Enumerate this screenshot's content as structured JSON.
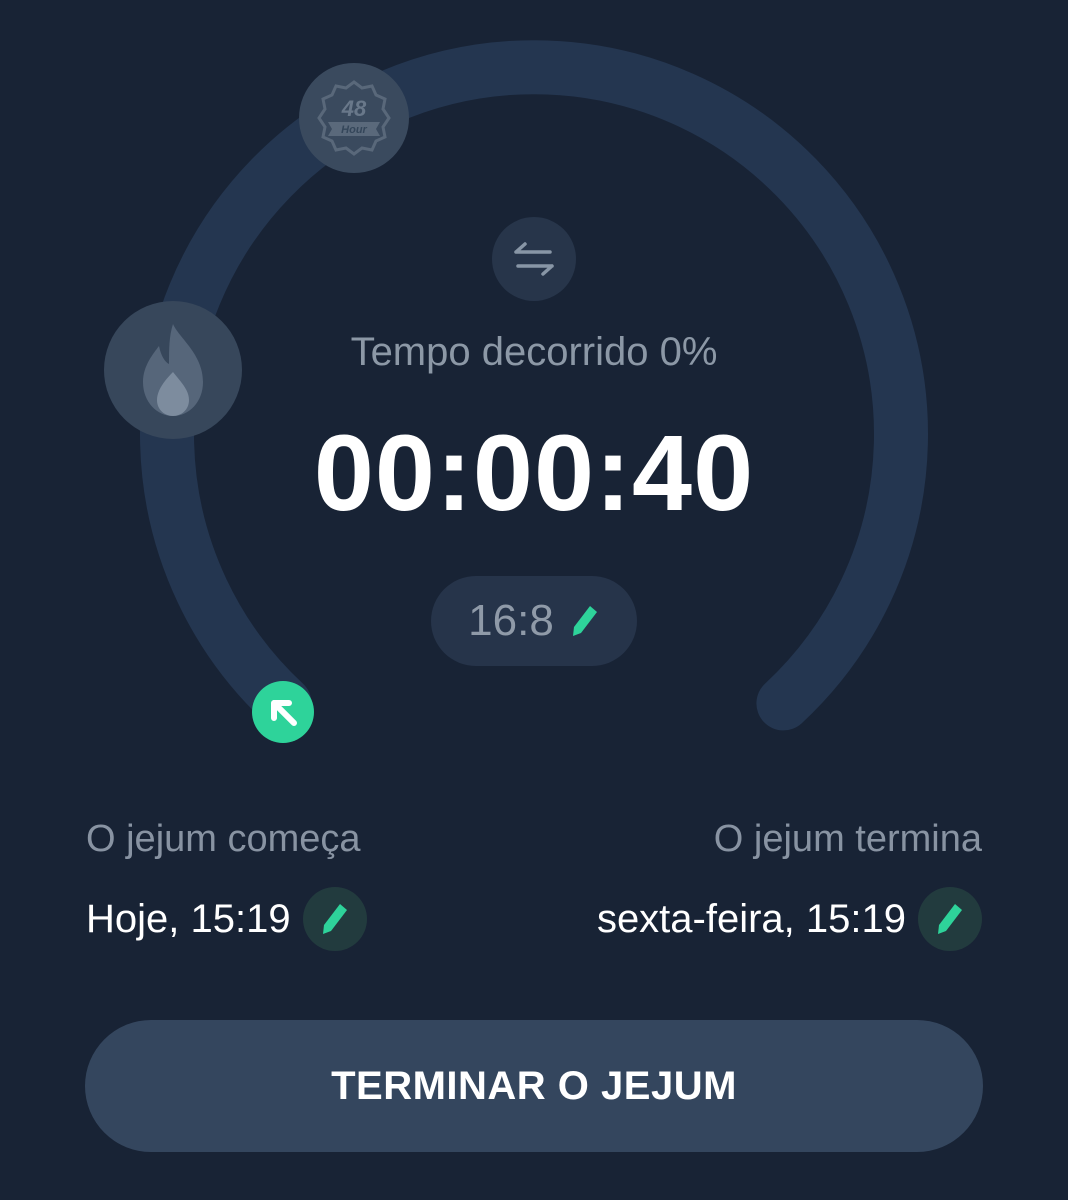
{
  "progress": {
    "fraction": 0,
    "label": "Tempo decorrido",
    "percent_text": "0%"
  },
  "timer": {
    "value": "00:00:40"
  },
  "plan": {
    "ratio": "16:8"
  },
  "badge": {
    "number": "48",
    "unit": "Hour"
  },
  "fast_start": {
    "label": "O jejum começa",
    "value": "Hoje, 15:19"
  },
  "fast_end": {
    "label": "O jejum termina",
    "value": "sexta-feira, 15:19"
  },
  "end_button": {
    "label": "TERMINAR O JEJUM"
  },
  "icons": {
    "badge": "48-hour-badge-icon",
    "flame": "flame-icon",
    "swap": "swap-arrows-icon",
    "edit": "pencil-icon",
    "start_marker": "arrow-up-left-icon"
  },
  "colors": {
    "background": "#182335",
    "track": "#243650",
    "accent": "#2ed39a"
  }
}
